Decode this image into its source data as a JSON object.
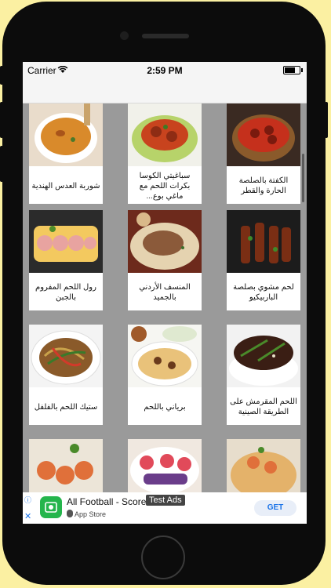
{
  "status_bar": {
    "carrier": "Carrier",
    "time": "2:59 PM"
  },
  "recipes": [
    {
      "title": "شوربة العدس الهندية"
    },
    {
      "title": "سباغيتي الكوسا بكرات اللحم مع ماغي بوع..."
    },
    {
      "title": "الكفتة بالصلصة الحارة والقطر"
    },
    {
      "title": "رول اللحم المفروم بالجبن"
    },
    {
      "title": "المنسف الأردني بالجميد"
    },
    {
      "title": "لحم مشوي بصلصة الباربيكيو"
    },
    {
      "title": "ستيك اللحم بالفلفل"
    },
    {
      "title": "برياني باللحم"
    },
    {
      "title": "اللحم المقرمش على الطريقة الصينية"
    },
    {
      "title": ""
    },
    {
      "title": ""
    },
    {
      "title": ""
    }
  ],
  "ad": {
    "title": "All Football - Score",
    "badge": "Test Ad",
    "title_tail": "s",
    "store": "App Store",
    "cta": "GET"
  },
  "colors": {
    "background": "#fbf0a2",
    "grid_bg": "#9a9a9a",
    "ad_logo": "#25b54c",
    "cta_text": "#1a73e8"
  }
}
